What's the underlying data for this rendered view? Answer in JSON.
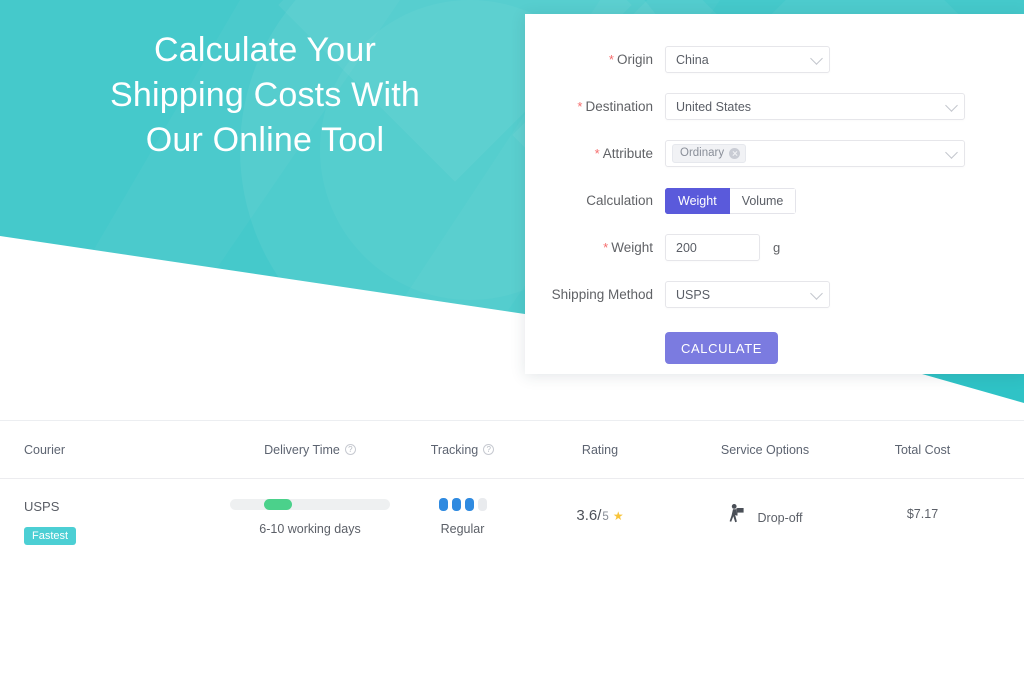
{
  "hero": {
    "title": "Calculate Your\nShipping Costs With\nOur Online Tool",
    "teal": "#45c9cb"
  },
  "form": {
    "origin": {
      "label": "Origin",
      "required": "*",
      "value": "China"
    },
    "destination": {
      "label": "Destination",
      "required": "*",
      "value": "United States"
    },
    "attribute": {
      "label": "Attribute",
      "required": "*",
      "tag": "Ordinary"
    },
    "calculation": {
      "label": "Calculation",
      "options": [
        "Weight",
        "Volume"
      ],
      "weight_label": "Weight",
      "volume_label": "Volume",
      "selected": "Weight"
    },
    "weight": {
      "label": "Weight",
      "required": "*",
      "value": "200",
      "unit": "g"
    },
    "shipping_method": {
      "label": "Shipping Method",
      "value": "USPS"
    },
    "submit_label": "CALCULATE",
    "accent_primary": "#5a5adb",
    "accent_submit": "#7b7be0"
  },
  "results": {
    "columns": {
      "courier": "Courier",
      "delivery_time": "Delivery Time",
      "tracking": "Tracking",
      "rating": "Rating",
      "service_options": "Service Options",
      "total_cost": "Total Cost"
    },
    "help_glyph": "?",
    "rows": [
      {
        "courier": "USPS",
        "badge": "Fastest",
        "delivery_time": "6-10 working days",
        "delivery_progress_pct": 21,
        "tracking_label": "Regular",
        "tracking_filled": 3,
        "tracking_total": 4,
        "rating_value": "3.6/",
        "rating_denominator": "5",
        "rating_star": "★",
        "service_option": "Drop-off",
        "total_cost": "$7.17"
      }
    ]
  }
}
